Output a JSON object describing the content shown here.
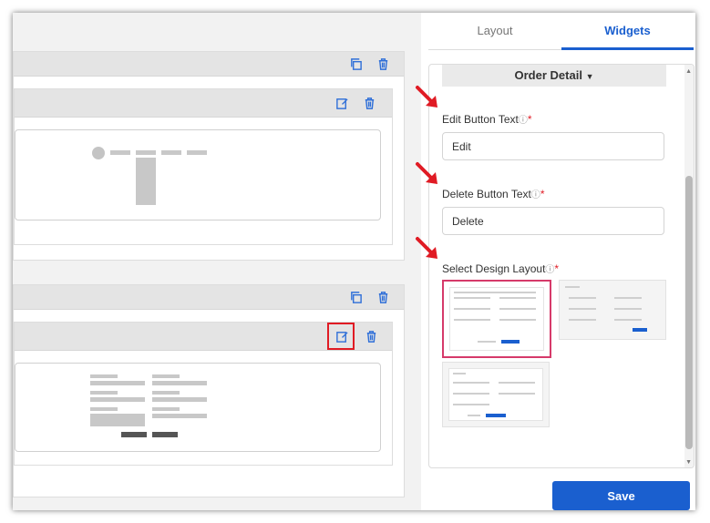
{
  "tabs": [
    {
      "label": "Layout",
      "active": false
    },
    {
      "label": "Widgets",
      "active": true
    }
  ],
  "widget_select": {
    "label": "Order Detail",
    "icon": "caret-down-icon"
  },
  "fields": {
    "edit_button_text": {
      "label": "Edit Button Text",
      "required_mark": "*",
      "value": "Edit"
    },
    "delete_button_text": {
      "label": "Delete Button Text",
      "required_mark": "*",
      "value": "Delete"
    },
    "design_layout": {
      "label": "Select Design Layout",
      "required_mark": "*",
      "selected_index": 0
    }
  },
  "save_label": "Save",
  "colors": {
    "accent": "#1a5fcf",
    "annotation": "#e01b24",
    "selection": "#d63a6a"
  },
  "icons": [
    "copy-icon",
    "delete-icon",
    "edit-icon",
    "help-icon",
    "red-arrow-icon"
  ]
}
